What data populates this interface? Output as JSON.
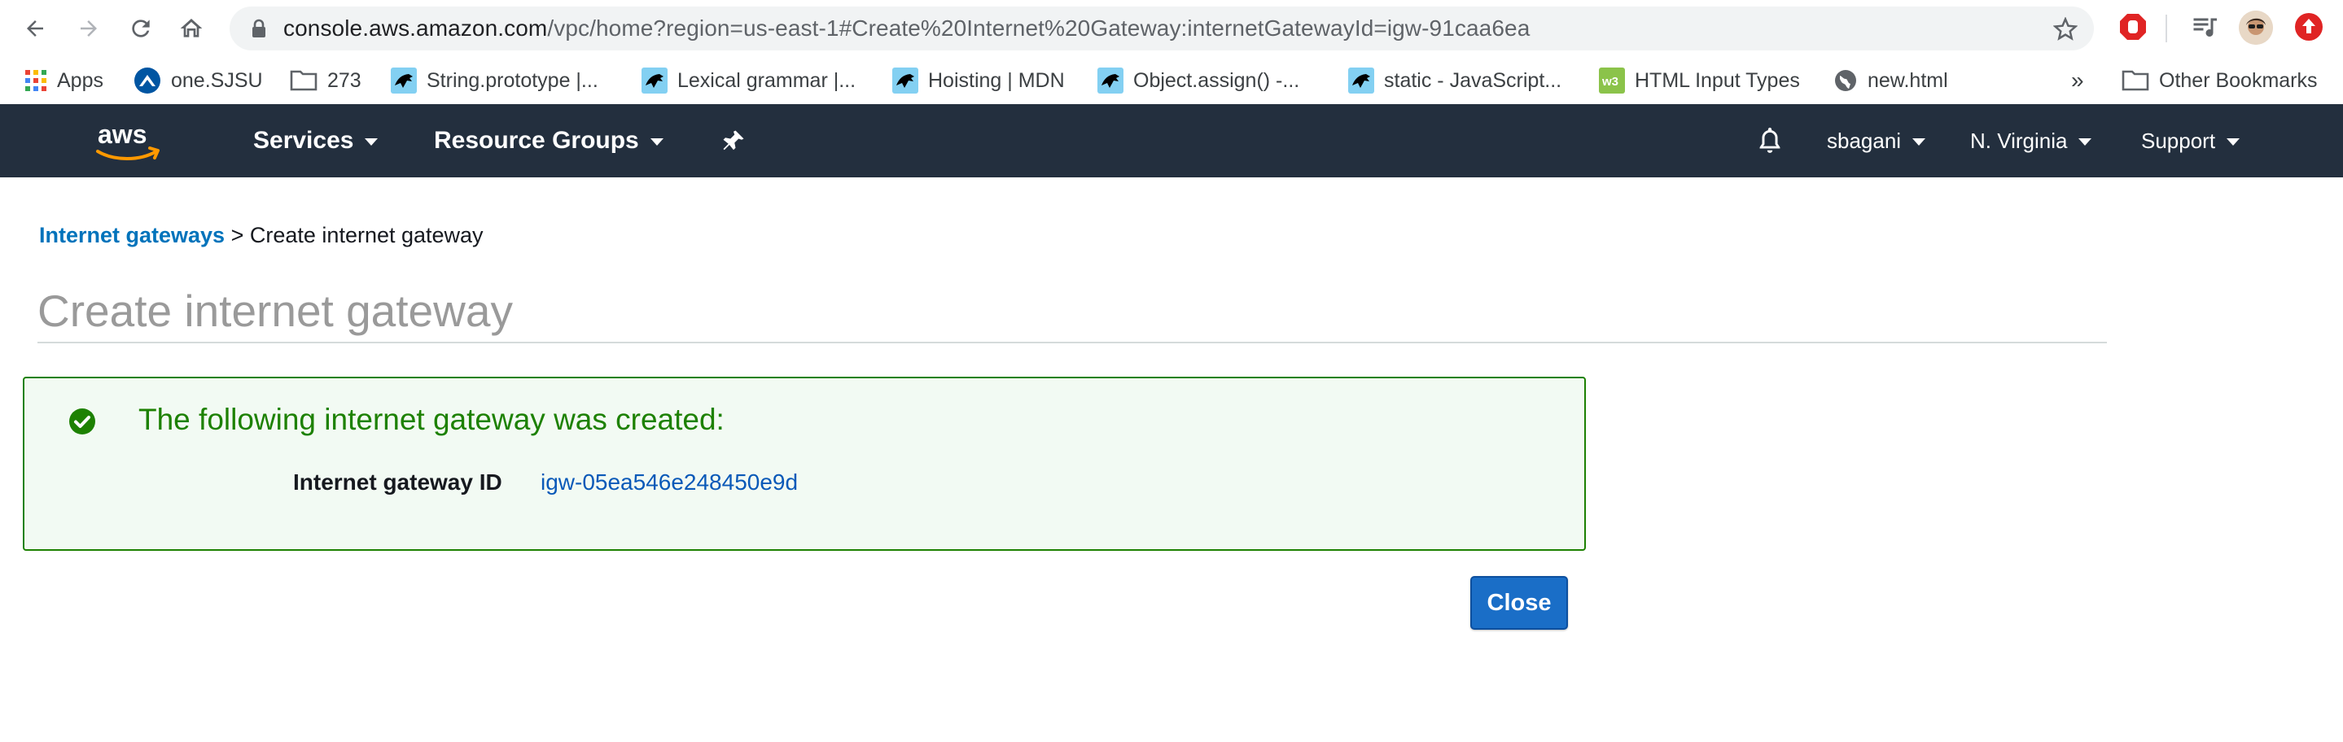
{
  "browser": {
    "url_host": "console.aws.amazon.com",
    "url_path": "/vpc/home?region=us-east-1#Create%20Internet%20Gateway:internetGatewayId=igw-91caa6ea",
    "bookmarks": [
      {
        "label": "Apps",
        "icon": "apps-grid-icon"
      },
      {
        "label": "one.SJSU",
        "icon": "sjsu-icon"
      },
      {
        "label": "273",
        "icon": "folder-icon"
      },
      {
        "label": "String.prototype |...",
        "icon": "mdn-icon"
      },
      {
        "label": "Lexical grammar |...",
        "icon": "mdn-icon"
      },
      {
        "label": "Hoisting | MDN",
        "icon": "mdn-icon"
      },
      {
        "label": "Object.assign() -...",
        "icon": "mdn-icon"
      },
      {
        "label": "static - JavaScript...",
        "icon": "mdn-icon"
      },
      {
        "label": "HTML Input Types",
        "icon": "w3schools-icon"
      },
      {
        "label": "new.html",
        "icon": "globe-icon"
      }
    ],
    "overflow_label": "»",
    "other_bookmarks": "Other Bookmarks"
  },
  "aws_nav": {
    "services": "Services",
    "resource_groups": "Resource Groups",
    "user": "sbagani",
    "region": "N. Virginia",
    "support": "Support"
  },
  "breadcrumb": {
    "link": "Internet gateways",
    "separator": ">",
    "current": "Create internet gateway"
  },
  "page_title": "Create internet gateway",
  "success": {
    "message": "The following internet gateway was created:",
    "id_label": "Internet gateway ID",
    "id_value": "igw-05ea546e248450e9d"
  },
  "close_button": "Close",
  "colors": {
    "aws_nav_bg": "#232f3e",
    "success_green": "#1d8102",
    "link_blue": "#0073bb",
    "button_blue": "#1a6ec7"
  }
}
